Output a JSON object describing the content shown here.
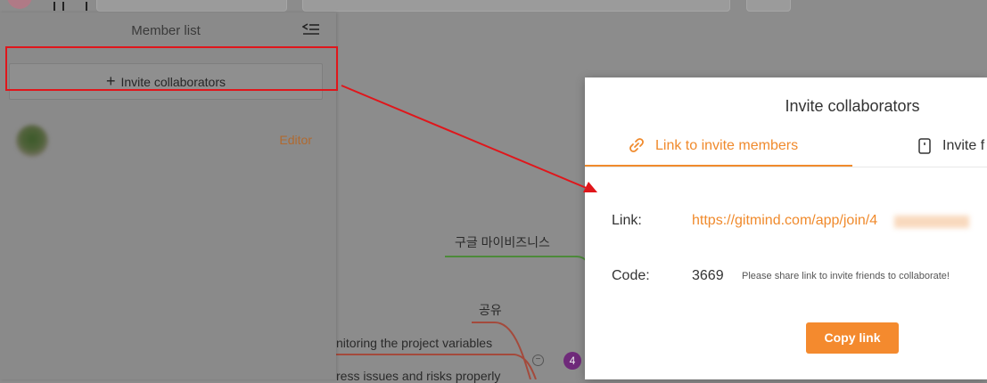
{
  "sidebar": {
    "title": "Member list",
    "invite_button": "Invite collaborators",
    "invite_plus": "+",
    "members": [
      {
        "name": "",
        "role": "Editor"
      }
    ]
  },
  "mindmap": {
    "nodes": [
      "구글 마이비즈니스",
      "공유",
      "nitoring the project variables",
      "ress issues and risks properly"
    ],
    "badge": "4",
    "collapse_symbol": "−"
  },
  "modal": {
    "title": "Invite collaborators",
    "tabs": [
      {
        "label": "Link to invite members",
        "active": true
      },
      {
        "label": "Invite f",
        "active": false
      }
    ],
    "link_label": "Link:",
    "link_value": "https://gitmind.com/app/join/4",
    "code_label": "Code:",
    "code_value": "3669",
    "code_hint": "Please share link to invite friends to collaborate!",
    "copy_button": "Copy link"
  },
  "colors": {
    "accent": "#f08a2c",
    "highlight": "#e0161b",
    "overlay": "#8c8c8c"
  },
  "icons": {
    "collapse": "collapse-list-icon",
    "link": "link-icon",
    "phone": "phone-icon",
    "plus": "plus-icon"
  }
}
